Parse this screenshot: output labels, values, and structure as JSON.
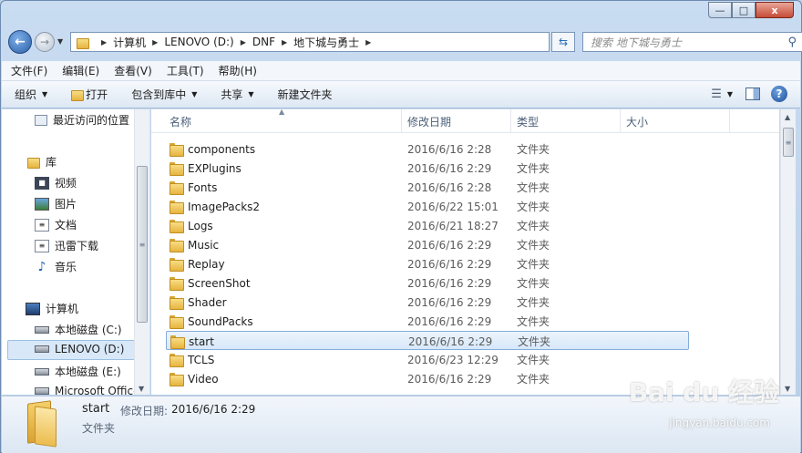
{
  "window": {
    "caption": {
      "minimize": "—",
      "maximize": "□",
      "close": "x"
    }
  },
  "address": {
    "crumbs": [
      "计算机",
      "LENOVO (D:)",
      "DNF",
      "地下城与勇士"
    ],
    "refresh_icon": "refresh-icon",
    "search_placeholder": "搜索 地下城与勇士"
  },
  "menubar": {
    "items": [
      "文件(F)",
      "编辑(E)",
      "查看(V)",
      "工具(T)",
      "帮助(H)"
    ]
  },
  "toolbar": {
    "organize": "组织",
    "open": "打开",
    "include_library": "包含到库中",
    "share": "共享",
    "new_folder": "新建文件夹",
    "help": "?"
  },
  "navpane": {
    "items": [
      {
        "label": "最近访问的位置",
        "icon": "recent-places-icon"
      },
      {
        "label": "库",
        "icon": "library-icon"
      },
      {
        "label": "视频",
        "icon": "video-icon"
      },
      {
        "label": "图片",
        "icon": "picture-icon"
      },
      {
        "label": "文档",
        "icon": "document-icon"
      },
      {
        "label": "迅雷下载",
        "icon": "download-icon"
      },
      {
        "label": "音乐",
        "icon": "music-icon"
      },
      {
        "label": "计算机",
        "icon": "computer-icon"
      },
      {
        "label": "本地磁盘 (C:)",
        "icon": "drive-icon"
      },
      {
        "label": "LENOVO (D:)",
        "icon": "drive-icon"
      },
      {
        "label": "本地磁盘 (E:)",
        "icon": "drive-icon"
      },
      {
        "label": "Microsoft Office",
        "icon": "drive-icon"
      }
    ],
    "selected": "LENOVO (D:)"
  },
  "columns": {
    "name": "名称",
    "date": "修改日期",
    "type": "类型",
    "size": "大小"
  },
  "files": [
    {
      "name": "components",
      "date": "2016/6/16 2:28",
      "type": "文件夹"
    },
    {
      "name": "EXPlugins",
      "date": "2016/6/16 2:29",
      "type": "文件夹"
    },
    {
      "name": "Fonts",
      "date": "2016/6/16 2:28",
      "type": "文件夹"
    },
    {
      "name": "ImagePacks2",
      "date": "2016/6/22 15:01",
      "type": "文件夹"
    },
    {
      "name": "Logs",
      "date": "2016/6/21 18:27",
      "type": "文件夹"
    },
    {
      "name": "Music",
      "date": "2016/6/16 2:29",
      "type": "文件夹"
    },
    {
      "name": "Replay",
      "date": "2016/6/16 2:29",
      "type": "文件夹"
    },
    {
      "name": "ScreenShot",
      "date": "2016/6/16 2:29",
      "type": "文件夹"
    },
    {
      "name": "Shader",
      "date": "2016/6/16 2:29",
      "type": "文件夹"
    },
    {
      "name": "SoundPacks",
      "date": "2016/6/16 2:29",
      "type": "文件夹"
    },
    {
      "name": "start",
      "date": "2016/6/16 2:29",
      "type": "文件夹",
      "selected": true
    },
    {
      "name": "TCLS",
      "date": "2016/6/23 12:29",
      "type": "文件夹"
    },
    {
      "name": "Video",
      "date": "2016/6/16 2:29",
      "type": "文件夹"
    }
  ],
  "details": {
    "name": "start",
    "modified_label": "修改日期:",
    "modified_value": "2016/6/16 2:29",
    "type": "文件夹"
  },
  "watermark": {
    "main": "Bai du 经验",
    "sub": "jingyan.baidu.com"
  }
}
